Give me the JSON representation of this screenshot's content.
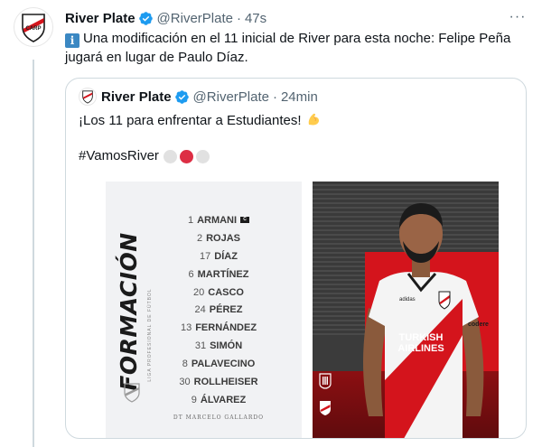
{
  "tweet": {
    "name": "River Plate",
    "handle": "@RiverPlate",
    "separator": "·",
    "time": "47s",
    "more": "···",
    "info_emoji": "i",
    "text": "Una modificación en el 11 inicial de River para esta noche: Felipe Peña jugará en lugar de Paulo Díaz."
  },
  "quote": {
    "name": "River Plate",
    "handle": "@RiverPlate",
    "separator": "·",
    "time": "24min",
    "text": "¡Los 11 para enfrentar a Estudiantes!",
    "hashtag": "#VamosRiver"
  },
  "lineup": {
    "title": "FORMACIÓN",
    "subtitle": "LIGA PROFESIONAL DE FÚTBOL",
    "captain_badge": "C",
    "players": [
      {
        "num": "1",
        "name": "ARMANI"
      },
      {
        "num": "2",
        "name": "ROJAS"
      },
      {
        "num": "17",
        "name": "DÍAZ"
      },
      {
        "num": "6",
        "name": "MARTÍNEZ"
      },
      {
        "num": "20",
        "name": "CASCO"
      },
      {
        "num": "24",
        "name": "PÉREZ"
      },
      {
        "num": "13",
        "name": "FERNÁNDEZ"
      },
      {
        "num": "31",
        "name": "SIMÓN"
      },
      {
        "num": "8",
        "name": "PALAVECINO"
      },
      {
        "num": "30",
        "name": "ROLLHEISER"
      },
      {
        "num": "9",
        "name": "ÁLVAREZ"
      }
    ],
    "coach": "DT MARCELO GALLARDO"
  },
  "photo": {
    "sponsor_line1": "TURKISH",
    "sponsor_line2": "AIRLINES",
    "kit_brand": "adidas",
    "sleeve_brand": "codere"
  },
  "colors": {
    "verified": "#1d9bf0",
    "river_red": "#d4141c",
    "text_primary": "#0f1419",
    "text_secondary": "#536471",
    "border": "#cfd9de"
  },
  "icons": {
    "verified": "verified-badge-icon",
    "more": "more-icon",
    "info": "information-emoji-icon",
    "muscle": "flexed-biceps-emoji-icon"
  }
}
